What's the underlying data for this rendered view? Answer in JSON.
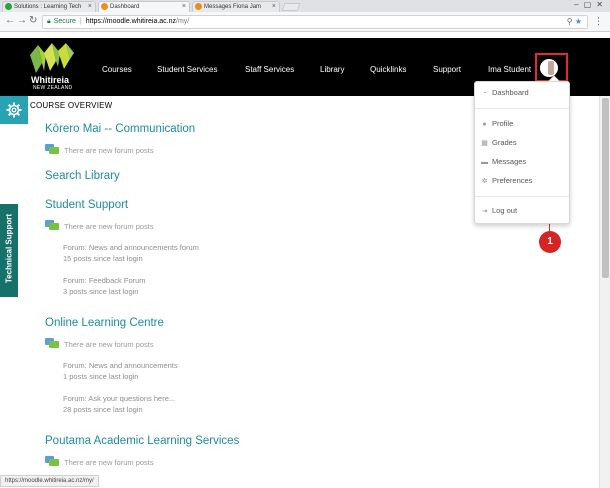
{
  "browser": {
    "tabs": [
      {
        "title": "Solutions : Learning Tech",
        "favicon_color": "#20a839"
      },
      {
        "title": "Dashboard",
        "favicon_color": "#f08d19"
      },
      {
        "title": "Messages Fiona Jam",
        "favicon_color": "#f08d19"
      }
    ],
    "address": {
      "secure_label": "Secure",
      "host": "https://moodle.whitireia.ac.nz",
      "path": "/my/"
    },
    "status_url": "https://moodle.whitireia.ac.nz/my/"
  },
  "site": {
    "logo_word": "Whitireia",
    "logo_sub": "NEW ZEALAND",
    "nav": [
      "Courses",
      "Student Services",
      "Staff Services",
      "Library",
      "Quicklinks",
      "Support"
    ],
    "user_name": "Ima Student"
  },
  "sidebar": {
    "technical_support": "Technical Support"
  },
  "overview": {
    "title": "COURSE OVERVIEW",
    "courses": [
      {
        "title": "Kōrero Mai -- Communication",
        "notice": "There are new forum posts",
        "details": []
      },
      {
        "title": "Search Library",
        "notice": "",
        "details": []
      },
      {
        "title": "Student Support",
        "notice": "There are new forum posts",
        "details": [
          {
            "forum": "Forum: News and announcements forum",
            "count": "15 posts since last login"
          },
          {
            "forum": "Forum: Feedback Forum",
            "count": "3 posts since last login"
          }
        ]
      },
      {
        "title": "Online Learning Centre",
        "notice": "There are new forum posts",
        "details": [
          {
            "forum": "Forum: News and announcements",
            "count": "1 posts since last login"
          },
          {
            "forum": "Forum: Ask your questions here...",
            "count": "28 posts since last login"
          }
        ]
      },
      {
        "title": "Poutama Academic Learning Services",
        "notice": "There are new forum posts",
        "details": []
      }
    ]
  },
  "user_menu": {
    "items": [
      {
        "label": "Dashboard",
        "icon": "dashboard-icon"
      },
      {
        "label": "Profile",
        "icon": "user-icon"
      },
      {
        "label": "Grades",
        "icon": "grades-icon"
      },
      {
        "label": "Messages",
        "icon": "messages-icon"
      },
      {
        "label": "Preferences",
        "icon": "gear-icon"
      },
      {
        "label": "Log out",
        "icon": "logout-icon"
      }
    ]
  },
  "annotation": {
    "step": "1",
    "color": "#e32b27"
  },
  "colors": {
    "accent_teal": "#27a3b3",
    "course_link": "#1f8a9e",
    "tech_support": "#157169",
    "navbar_bg": "#000000"
  }
}
